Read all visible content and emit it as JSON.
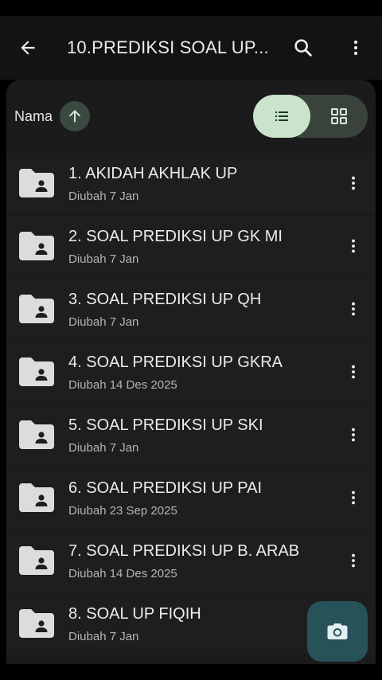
{
  "appbar": {
    "title": "10.PREDIKSI SOAL UP...",
    "back_icon": "arrow-back-icon",
    "search_icon": "search-icon",
    "more_icon": "more-vertical-icon"
  },
  "sort": {
    "label": "Nama",
    "direction_icon": "arrow-up-icon"
  },
  "view_toggle": {
    "list_icon": "list-view-icon",
    "grid_icon": "grid-view-icon",
    "selected": "list"
  },
  "files": [
    {
      "name": "1. AKIDAH AKHLAK UP",
      "modified": "Diubah 7 Jan"
    },
    {
      "name": "2. SOAL PREDIKSI UP GK MI",
      "modified": "Diubah 7 Jan"
    },
    {
      "name": "3. SOAL PREDIKSI UP QH",
      "modified": "Diubah 7 Jan"
    },
    {
      "name": "4. SOAL PREDIKSI UP GKRA",
      "modified": "Diubah 14 Des 2025"
    },
    {
      "name": "5. SOAL PREDIKSI UP SKI",
      "modified": "Diubah 7 Jan"
    },
    {
      "name": "6. SOAL PREDIKSI UP PAI",
      "modified": "Diubah 23 Sep 2025"
    },
    {
      "name": "7. SOAL PREDIKSI UP B. ARAB",
      "modified": "Diubah 14 Des 2025"
    },
    {
      "name": "8. SOAL UP FIQIH",
      "modified": "Diubah 7 Jan"
    }
  ],
  "fab": {
    "icon": "camera-icon"
  },
  "colors": {
    "background": "#1b1b1b",
    "list_toggle_active": "#c9e4cb",
    "sort_badge": "#3b4a40",
    "fab": "#27525a"
  }
}
